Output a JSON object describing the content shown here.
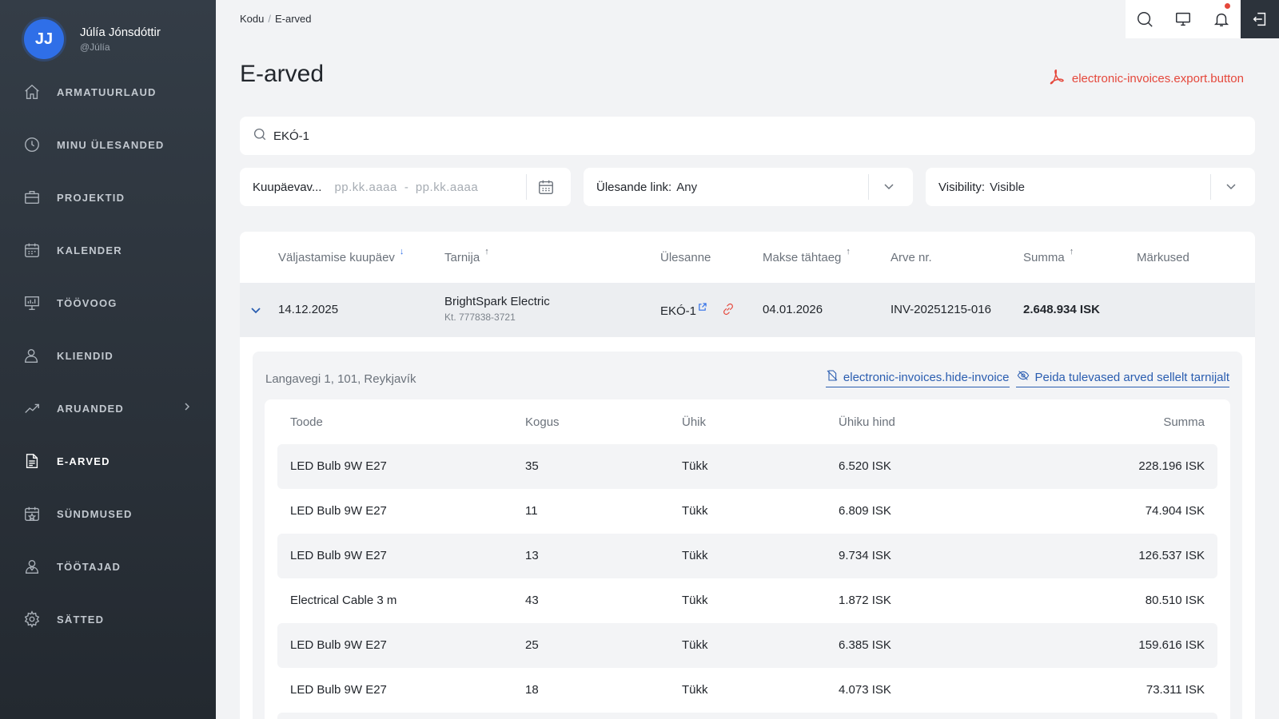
{
  "user": {
    "initials": "JJ",
    "name": "Júlía Jónsdóttir",
    "handle": "@Júlía"
  },
  "nav": [
    {
      "label": "ARMATUURLAUD",
      "icon": "home-icon"
    },
    {
      "label": "MINU ÜLESANDED",
      "icon": "clock-icon"
    },
    {
      "label": "PROJEKTID",
      "icon": "briefcase-icon"
    },
    {
      "label": "KALENDER",
      "icon": "calendar-icon"
    },
    {
      "label": "TÖÖVOOG",
      "icon": "presentation-board-icon"
    },
    {
      "label": "KLIENDID",
      "icon": "user-icon"
    },
    {
      "label": "ARUANDED",
      "icon": "trend-chart-icon"
    },
    {
      "label": "E-ARVED",
      "icon": "document-icon"
    },
    {
      "label": "SÜNDMUSED",
      "icon": "calendar-star-icon"
    },
    {
      "label": "TÖÖTAJAD",
      "icon": "users-icon"
    },
    {
      "label": "SÄTTED",
      "icon": "gear-icon"
    }
  ],
  "breadcrumb": {
    "home": "Kodu",
    "current": "E-arved"
  },
  "page": {
    "title": "E-arved",
    "export_label": "electronic-invoices.export.button"
  },
  "search": {
    "value": "EKÓ-1"
  },
  "filters": {
    "date_label": "Kuupäevav...",
    "date_from_placeholder": "pp.kk.aaaa",
    "date_to_placeholder": "pp.kk.aaaa",
    "date_separator": "-",
    "task_label": "Ülesande link:",
    "task_value": "Any",
    "visibility_label": "Visibility:",
    "visibility_value": "Visible"
  },
  "table": {
    "columns": [
      "Väljastamise kuupäev",
      "Tarnija",
      "Ülesanne",
      "Makse tähtaeg",
      "Arve nr.",
      "Summa",
      "Märkused"
    ],
    "row": {
      "date": "14.12.2025",
      "supplier": "BrightSpark Electric",
      "supplier_id": "Kt. 777838-3721",
      "task": "EKÓ-1",
      "due": "04.01.2026",
      "invoice_no": "INV-20251215-016",
      "sum": "2.648.934 ISK",
      "notes": ""
    }
  },
  "details": {
    "address": "Langavegi 1, 101, Reykjavík",
    "hide_invoice_label": "electronic-invoices.hide-invoice",
    "hide_future_label": "Peida tulevased arved sellelt tarnijalt",
    "columns": [
      "Toode",
      "Kogus",
      "Ühik",
      "Ühiku hind",
      "Summa"
    ],
    "items": [
      {
        "product": "LED Bulb 9W E27",
        "qty": "35",
        "unit": "Tükk",
        "unit_price": "6.520 ISK",
        "sum": "228.196 ISK"
      },
      {
        "product": "LED Bulb 9W E27",
        "qty": "11",
        "unit": "Tükk",
        "unit_price": "6.809 ISK",
        "sum": "74.904 ISK"
      },
      {
        "product": "LED Bulb 9W E27",
        "qty": "13",
        "unit": "Tükk",
        "unit_price": "9.734 ISK",
        "sum": "126.537 ISK"
      },
      {
        "product": "Electrical Cable 3 m",
        "qty": "43",
        "unit": "Tükk",
        "unit_price": "1.872 ISK",
        "sum": "80.510 ISK"
      },
      {
        "product": "LED Bulb 9W E27",
        "qty": "25",
        "unit": "Tükk",
        "unit_price": "6.385 ISK",
        "sum": "159.616 ISK"
      },
      {
        "product": "LED Bulb 9W E27",
        "qty": "18",
        "unit": "Tükk",
        "unit_price": "4.073 ISK",
        "sum": "73.311 ISK"
      }
    ]
  },
  "colors": {
    "accent": "#2f6fe8",
    "danger": "#e5473b",
    "link": "#2a5db0",
    "sidebar": "#2e363f"
  }
}
